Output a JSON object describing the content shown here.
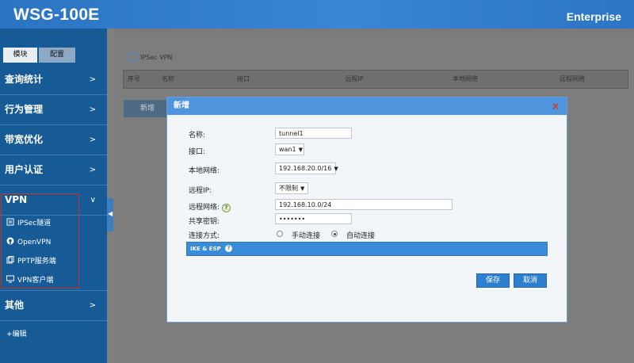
{
  "header": {
    "brand": "WSG-100E",
    "edition": "Enterprise"
  },
  "sidebar": {
    "tabs": [
      {
        "label": "模块"
      },
      {
        "label": "配置"
      }
    ],
    "items": [
      {
        "label": "查询统计",
        "chevron": ">"
      },
      {
        "label": "行为管理",
        "chevron": ">"
      },
      {
        "label": "带宽优化",
        "chevron": ">"
      },
      {
        "label": "用户认证",
        "chevron": ">"
      },
      {
        "label": "VPN",
        "chevron": "∨"
      },
      {
        "label": "其他",
        "chevron": ">"
      }
    ],
    "vpn_sub": [
      {
        "label": "IPSec隧道",
        "icon": "tunnel-icon"
      },
      {
        "label": "OpenVPN",
        "icon": "openvpn-icon"
      },
      {
        "label": "PPTP服务端",
        "icon": "server-icon"
      },
      {
        "label": "VPN客户端",
        "icon": "monitor-icon"
      }
    ],
    "edit_label": "+编辑"
  },
  "content": {
    "title": "IPSec VPN",
    "columns": [
      "序号",
      "名称",
      "接口",
      "远程IP",
      "本地网络",
      "远程网络"
    ],
    "new_button": "新增"
  },
  "dialog": {
    "title": "新增",
    "close": "×",
    "fields": {
      "name": {
        "label": "名称:",
        "value": "tunnel1"
      },
      "interface": {
        "label": "接口:",
        "value": "wan1"
      },
      "local_net": {
        "label": "本地网络:",
        "value": "192.168.20.0/16"
      },
      "remote_ip": {
        "label": "远程IP:",
        "value": "不限制"
      },
      "remote_net": {
        "label": "远程网络:",
        "value": "192.168.10.0/24"
      },
      "psk": {
        "label": "共享密钥:",
        "value": "•••••••"
      },
      "conn_mode": {
        "label": "连接方式:",
        "options": [
          "手动连接",
          "自动连接"
        ],
        "selected": "自动连接"
      }
    },
    "ike_bar": "IKE & ESP",
    "help_glyph": "?",
    "save": "保存",
    "cancel": "取消"
  },
  "colors": {
    "header": "#2a74c2",
    "sidebar": "#165b96",
    "dialog_header": "#4e95dd",
    "button": "#2f7fd0",
    "close": "#d9342b"
  }
}
